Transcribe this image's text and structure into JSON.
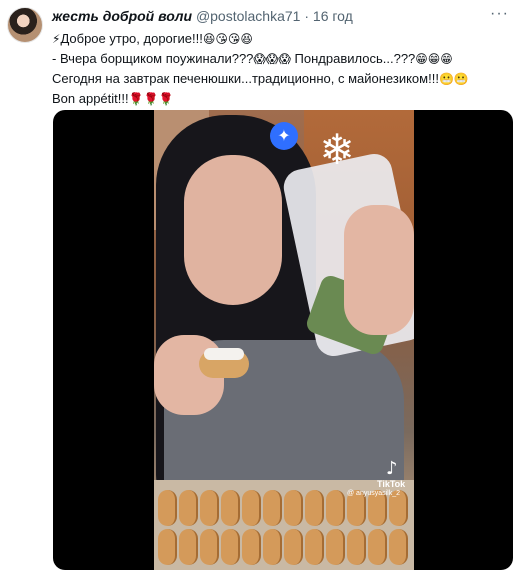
{
  "tweet": {
    "author": "жесть доброй воли",
    "handle": "@postolachka71",
    "separator": "·",
    "time": "16 год",
    "more_icon": "more-options-icon",
    "lines": [
      {
        "prefix_emoji": "⚡",
        "text": "Доброе утро, дорогие!!!",
        "emoji": "😆😘😘😆"
      },
      {
        "prefix_emoji": "",
        "text": "- Вчера борщиком поужинали???",
        "emoji": "😱😱😱"
      },
      {
        "prefix_emoji": "",
        "text": " Пондравилось...???",
        "emoji": "😁😁😁"
      },
      {
        "prefix_emoji": "",
        "text": "Сегодня на завтрак печенюшки...традиционно, с майонезиком!!!",
        "emoji": "😬😬"
      },
      {
        "prefix_emoji": "",
        "text": "Bon appétit!!!",
        "emoji": "🌹🌹🌹"
      }
    ]
  },
  "video": {
    "tiktok_brand": "TikTok",
    "tiktok_user": "@ anyusyasilk_2",
    "sparkle_icon": "ai-sparkle-icon",
    "snowflake_icon": "snowflake-decoration-icon"
  },
  "colors": {
    "text": "#0f1419",
    "muted": "#536471",
    "media_bg": "#000000",
    "sparkle": "#2f6fff"
  }
}
